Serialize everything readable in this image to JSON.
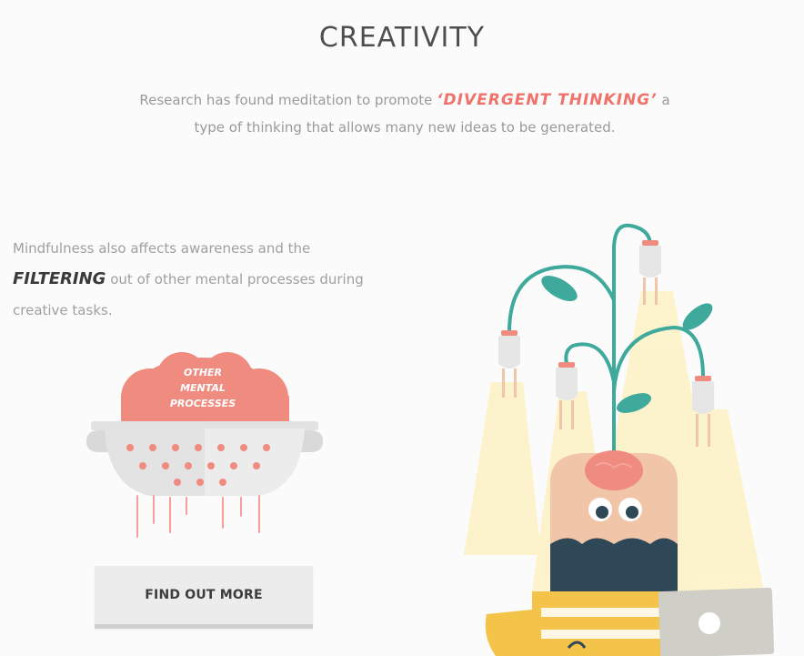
{
  "title": "CREATIVITY",
  "intro": {
    "before": "Research has found meditation to promote ",
    "highlight": "‘DIVERGENT THINKING’",
    "after": " a type of thinking that allows many new ideas to be generated."
  },
  "side": {
    "before": "Mindfulness also affects awareness and the ",
    "highlight": "FILTERING",
    "after": " out of other mental processes during creative tasks."
  },
  "cloud_label": [
    "OTHER",
    "MENTAL",
    "PROCESSES"
  ],
  "button_label": "FIND OUT MORE",
  "colors": {
    "accent": "#f0726a",
    "teal": "#3fa99b",
    "navy": "#2f4858",
    "yellow": "#f3c34a",
    "skin": "#f1c5a8"
  }
}
